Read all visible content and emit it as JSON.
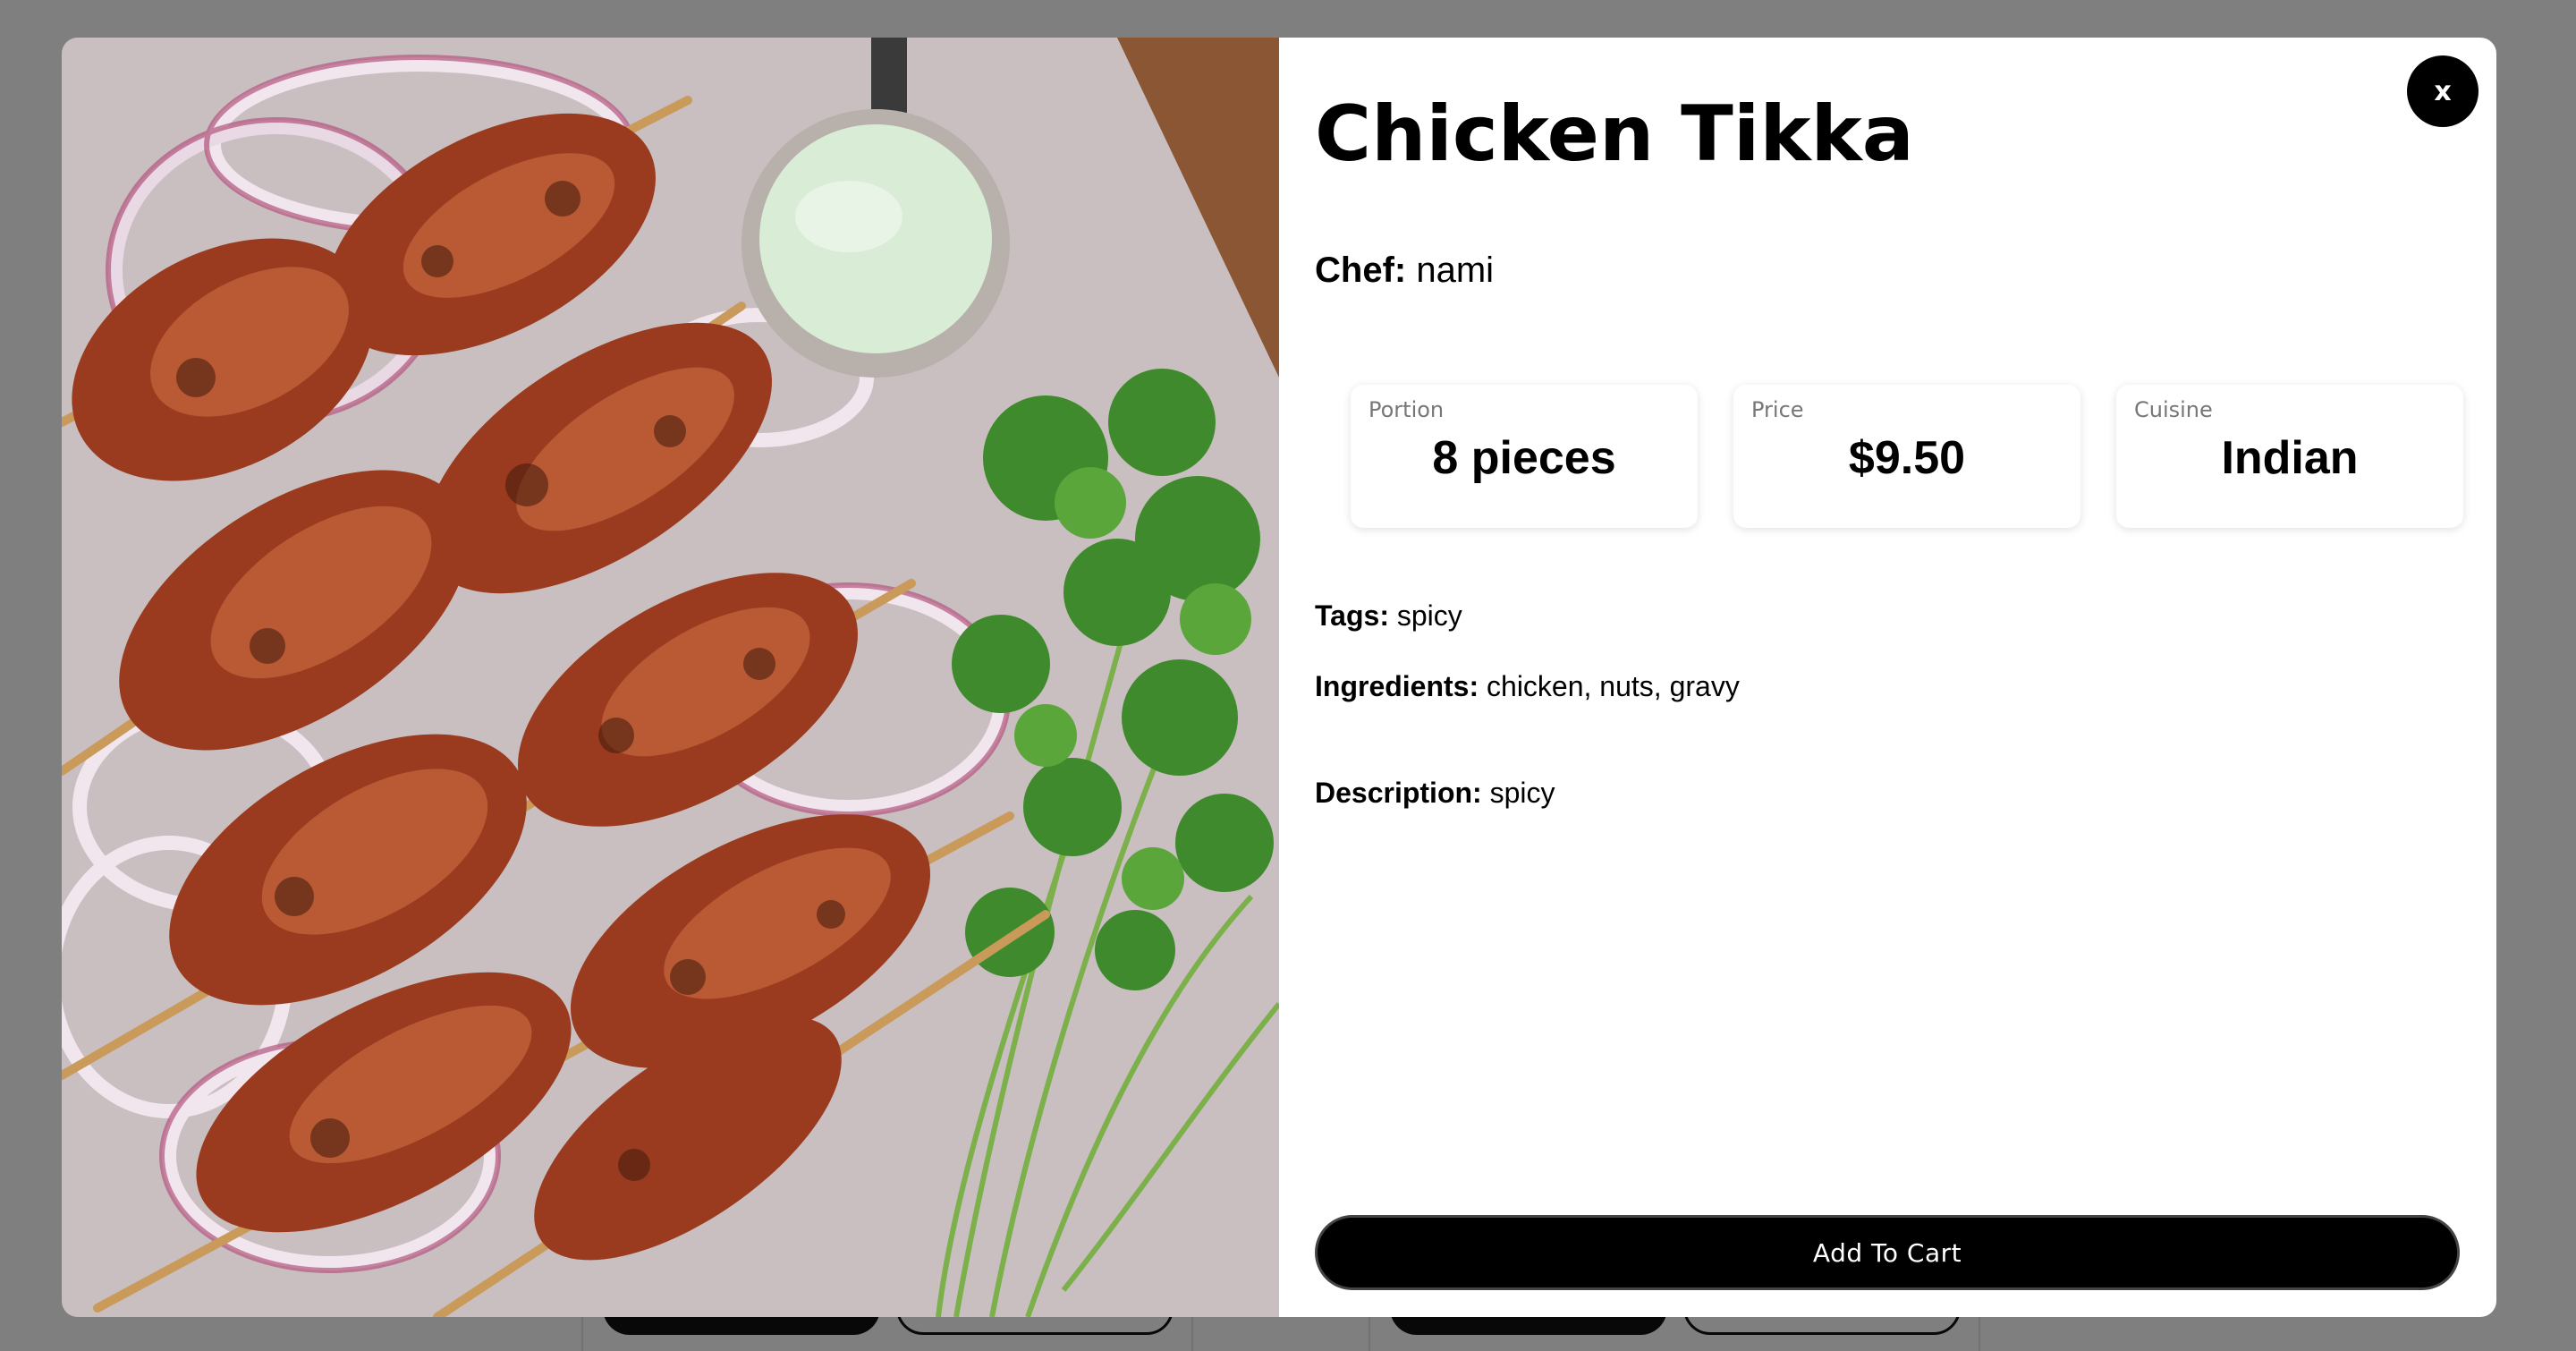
{
  "background": {
    "cards": [
      {
        "primary_label": "",
        "secondary_label": ""
      },
      {
        "primary_label": "",
        "secondary_label": ""
      }
    ]
  },
  "modal": {
    "image": {
      "subject": "chicken tikka skewers with onion rings, cilantro and mint chutney"
    },
    "close_label": "x",
    "title": "Chicken Tikka",
    "chef": {
      "label": "Chef:",
      "value": "nami"
    },
    "stats": [
      {
        "label": "Portion",
        "value": "8 pieces"
      },
      {
        "label": "Price",
        "value": "$9.50"
      },
      {
        "label": "Cuisine",
        "value": "Indian"
      }
    ],
    "tags": {
      "label": "Tags:",
      "value": "spicy"
    },
    "ingredients": {
      "label": "Ingredients:",
      "value": "chicken, nuts, gravy"
    },
    "description": {
      "label": "Description:",
      "value": "spicy"
    },
    "add_to_cart_label": "Add To Cart"
  }
}
